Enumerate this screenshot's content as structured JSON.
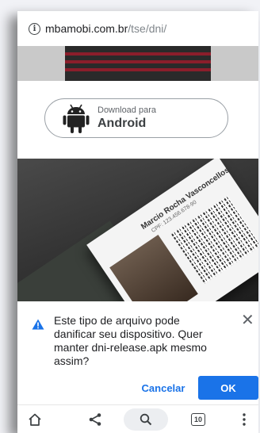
{
  "browser": {
    "url_host": "mbamobi.com.br",
    "url_path": "/tse/dni/"
  },
  "download": {
    "small_label": "Download para",
    "big_label": "Android"
  },
  "card": {
    "name": "Marcio Rocha Vasconcellos",
    "sub": "CPF: 123.456.678-90"
  },
  "dialog": {
    "message": "Este tipo de arquivo pode danificar seu dispositivo. Quer manter dni-release.apk mesmo assim?",
    "cancel_label": "Cancelar",
    "ok_label": "OK"
  },
  "navbar": {
    "tab_count": "10"
  },
  "colors": {
    "accent": "#1a73e8",
    "warning": "#1a73e8"
  },
  "icons": [
    "info-icon",
    "android-icon",
    "warning-icon",
    "close-icon",
    "home-icon",
    "share-icon",
    "search-icon",
    "tabs-icon",
    "more-icon"
  ]
}
